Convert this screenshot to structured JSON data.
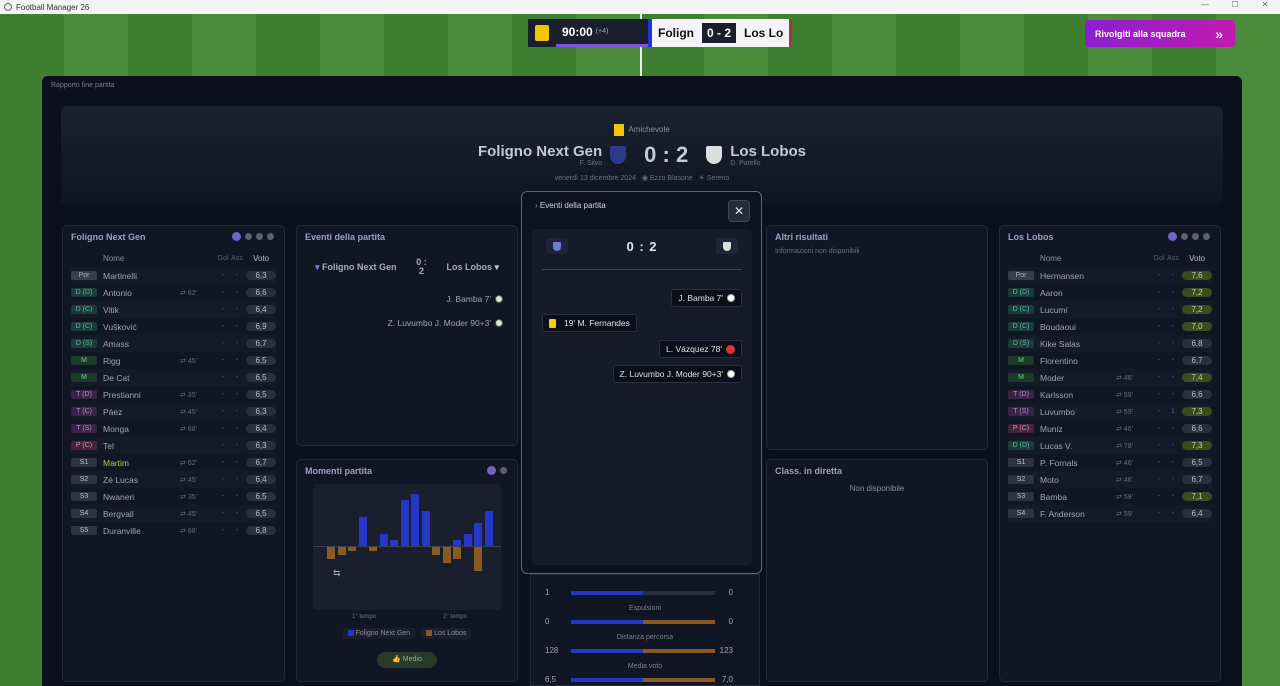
{
  "window": {
    "title": "Football Manager 26"
  },
  "topbar": {
    "clock": "90:00",
    "added": "(+4)",
    "home_short": "Folign",
    "score": "0 - 2",
    "away_short": "Los Lo",
    "cta": "Rivolgiti alla squadra"
  },
  "breadcrumb": "Rapporto fine partita",
  "header": {
    "competition": "Amichevole",
    "home": "Foligno Next Gen",
    "away": "Los Lobos",
    "score": "0 : 2",
    "home_manager": "F. Silvo",
    "away_manager": "D. Patello",
    "date": "venerdì 13 dicembre 2024",
    "stadium": "Ezzo Blasone",
    "weather": "Sereno"
  },
  "home_panel": {
    "title": "Foligno Next Gen",
    "headers": {
      "name": "Nome",
      "goals": "Gol",
      "assists": "Ass",
      "rating": "Voto"
    },
    "players": [
      {
        "pos": "Por",
        "cls": "p-gk",
        "name": "Martinelli",
        "sub": "",
        "g": "-",
        "a": "-",
        "v": "6,3",
        "hi": false
      },
      {
        "pos": "D (D)",
        "cls": "p-d",
        "name": "Antonio",
        "sub": "62'",
        "g": "-",
        "a": "-",
        "v": "6,6",
        "hi": false
      },
      {
        "pos": "D (C)",
        "cls": "p-d",
        "name": "Vitik",
        "sub": "",
        "g": "-",
        "a": "-",
        "v": "6,4",
        "hi": false
      },
      {
        "pos": "D (C)",
        "cls": "p-d",
        "name": "Vušković",
        "sub": "",
        "g": "-",
        "a": "-",
        "v": "6,9",
        "hi": false
      },
      {
        "pos": "D (S)",
        "cls": "p-d",
        "name": "Amass",
        "sub": "",
        "g": "-",
        "a": "-",
        "v": "6,7",
        "hi": false
      },
      {
        "pos": "M",
        "cls": "p-m",
        "name": "Rigg",
        "sub": "45'",
        "g": "-",
        "a": "-",
        "v": "6,5",
        "hi": false
      },
      {
        "pos": "M",
        "cls": "p-m",
        "name": "De Cat",
        "sub": "",
        "g": "-",
        "a": "-",
        "v": "6,5",
        "hi": false
      },
      {
        "pos": "T (D)",
        "cls": "p-t",
        "name": "Prestianni",
        "sub": "35'",
        "g": "-",
        "a": "-",
        "v": "6,5",
        "hi": false
      },
      {
        "pos": "T (C)",
        "cls": "p-t",
        "name": "Páez",
        "sub": "45'",
        "g": "-",
        "a": "-",
        "v": "6,3",
        "hi": false
      },
      {
        "pos": "T (S)",
        "cls": "p-t",
        "name": "Monga",
        "sub": "68'",
        "g": "-",
        "a": "-",
        "v": "6,4",
        "hi": false
      },
      {
        "pos": "P (C)",
        "cls": "p-p",
        "name": "Tel",
        "sub": "",
        "g": "-",
        "a": "-",
        "v": "6,3",
        "hi": false
      },
      {
        "pos": "S1",
        "cls": "p-s",
        "name": "Martim",
        "sub": "62'",
        "g": "-",
        "a": "-",
        "v": "6,7",
        "hi": false
      },
      {
        "pos": "S2",
        "cls": "p-s",
        "name": "Zé Lucas",
        "sub": "45'",
        "g": "-",
        "a": "-",
        "v": "6,4",
        "hi": false
      },
      {
        "pos": "S3",
        "cls": "p-s",
        "name": "Nwaneri",
        "sub": "35'",
        "g": "-",
        "a": "-",
        "v": "6,5",
        "hi": false
      },
      {
        "pos": "S4",
        "cls": "p-s",
        "name": "Bergvall",
        "sub": "45'",
        "g": "-",
        "a": "-",
        "v": "6,5",
        "hi": false
      },
      {
        "pos": "S5",
        "cls": "p-s",
        "name": "Duranville",
        "sub": "68'",
        "g": "-",
        "a": "-",
        "v": "6,8",
        "hi": false
      }
    ]
  },
  "away_panel": {
    "title": "Los Lobos",
    "headers": {
      "name": "Nome",
      "goals": "Gol",
      "assists": "Ass",
      "rating": "Voto"
    },
    "players": [
      {
        "pos": "Por",
        "cls": "p-gk",
        "name": "Hermansen",
        "sub": "",
        "g": "-",
        "a": "-",
        "v": "7,6",
        "hi": true
      },
      {
        "pos": "D (D)",
        "cls": "p-d",
        "name": "Aaron",
        "sub": "",
        "g": "-",
        "a": "-",
        "v": "7,2",
        "hi": true
      },
      {
        "pos": "D (C)",
        "cls": "p-d",
        "name": "Lucumí",
        "sub": "",
        "g": "-",
        "a": "-",
        "v": "7,2",
        "hi": true
      },
      {
        "pos": "D (C)",
        "cls": "p-d",
        "name": "Boudaoui",
        "sub": "",
        "g": "-",
        "a": "-",
        "v": "7,0",
        "hi": true
      },
      {
        "pos": "D (S)",
        "cls": "p-d",
        "name": "Kike Salas",
        "sub": "",
        "g": "-",
        "a": "-",
        "v": "6,8",
        "hi": false
      },
      {
        "pos": "M",
        "cls": "p-m",
        "name": "Florentino",
        "sub": "",
        "g": "-",
        "a": "-",
        "v": "6,7",
        "hi": false
      },
      {
        "pos": "M",
        "cls": "p-m",
        "name": "Moder",
        "sub": "46'",
        "g": "-",
        "a": "-",
        "v": "7,4",
        "hi": true
      },
      {
        "pos": "T (D)",
        "cls": "p-t",
        "name": "Karlsson",
        "sub": "59'",
        "g": "-",
        "a": "-",
        "v": "6,6",
        "hi": false
      },
      {
        "pos": "T (S)",
        "cls": "p-t",
        "name": "Luvumbo",
        "sub": "59'",
        "g": "-",
        "a": "1",
        "v": "7,3",
        "hi": true
      },
      {
        "pos": "P (C)",
        "cls": "p-p",
        "name": "Muniz",
        "sub": "46'",
        "g": "-",
        "a": "-",
        "v": "6,6",
        "hi": false
      },
      {
        "pos": "D (D)",
        "cls": "p-d",
        "name": "Lucas V.",
        "sub": "78'",
        "g": "-",
        "a": "-",
        "v": "7,3",
        "hi": true
      },
      {
        "pos": "S1",
        "cls": "p-s",
        "name": "P. Fornals",
        "sub": "46'",
        "g": "-",
        "a": "-",
        "v": "6,5",
        "hi": false
      },
      {
        "pos": "S2",
        "cls": "p-s",
        "name": "Moto",
        "sub": "46'",
        "g": "-",
        "a": "-",
        "v": "6,7",
        "hi": false
      },
      {
        "pos": "S3",
        "cls": "p-s",
        "name": "Bamba",
        "sub": "59'",
        "g": "-",
        "a": "-",
        "v": "7,1",
        "hi": true
      },
      {
        "pos": "S4",
        "cls": "p-s",
        "name": "F. Anderson",
        "sub": "59'",
        "g": "-",
        "a": "-",
        "v": "6,4",
        "hi": false
      }
    ]
  },
  "events_panel": {
    "title": "Eventi della partita",
    "home": "Foligno Next Gen",
    "score_top": "0 :",
    "score_bottom": "2",
    "away": "Los Lobos",
    "items": [
      "J. Bamba 7'",
      "Z. Luvumbo J. Moder 90+3'"
    ]
  },
  "moments_panel": {
    "title": "Momenti partita",
    "first_half": "1° tempo",
    "second_half": "2° tempo",
    "legend_home": "Foligno Next Gen",
    "legend_away": "Los Lobos",
    "medio": "Medio"
  },
  "chart_data": {
    "type": "bar",
    "series": [
      {
        "name": "Foligno Next Gen",
        "values": [
          0,
          0,
          0,
          5,
          0,
          2,
          1,
          8,
          9,
          6,
          0,
          0,
          1,
          2,
          4,
          6
        ]
      },
      {
        "name": "Los Lobos",
        "values": [
          3,
          2,
          1,
          0,
          1,
          0,
          0,
          0,
          0,
          0,
          2,
          4,
          3,
          0,
          6,
          0
        ]
      }
    ],
    "colors": {
      "home": "#2536c9",
      "away": "#8a5a25"
    }
  },
  "other_results": {
    "title": "Altri risultati",
    "text": "Informazioni non disponibili"
  },
  "live_table": {
    "title": "Class. in diretta",
    "text": "Non disponibile"
  },
  "stats": [
    {
      "label": "",
      "home": "1",
      "away": "0",
      "hf": 1.0,
      "af": 0.0
    },
    {
      "label": "Espulsioni",
      "home": "0",
      "away": "0",
      "hf": 1.0,
      "af": 1.0
    },
    {
      "label": "Distanza percorsa",
      "home": "128",
      "away": "123",
      "hf": 1.0,
      "af": 1.0
    },
    {
      "label": "Media voto",
      "home": "6,5",
      "away": "7,0",
      "hf": 1.0,
      "af": 1.0
    }
  ],
  "modal": {
    "title": "Eventi della partita",
    "score": "0 : 2",
    "events": [
      {
        "text": "J. Bamba 7'",
        "side": "away",
        "kind": "goal"
      },
      {
        "text": "19' M. Fernandes",
        "side": "home",
        "kind": "yellow"
      },
      {
        "text": "L. Vázquez 78'",
        "side": "away",
        "kind": "red"
      },
      {
        "text": "Z. Luvumbo J. Moder 90+3'",
        "side": "away",
        "kind": "goal"
      }
    ]
  }
}
